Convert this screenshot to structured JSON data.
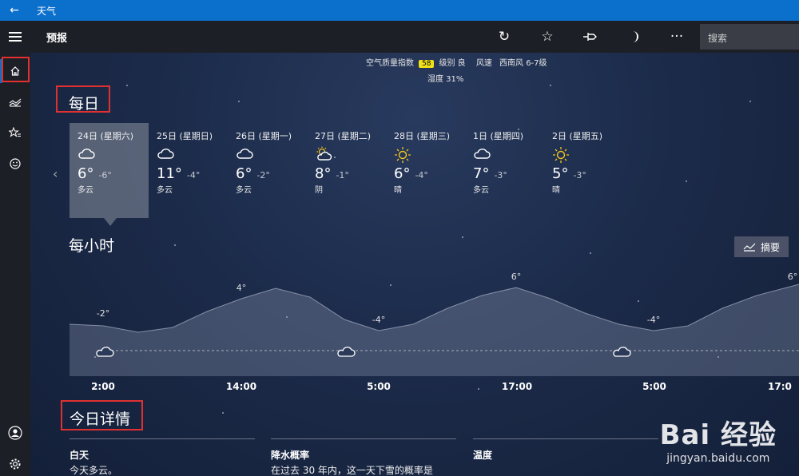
{
  "titlebar": {
    "back_icon": "back-arrow-icon",
    "title": "天气"
  },
  "commandbar": {
    "title": "预报",
    "actions": [
      {
        "name": "refresh-icon",
        "glyph": "↻"
      },
      {
        "name": "favorite-star-icon",
        "glyph": "☆"
      },
      {
        "name": "pin-icon",
        "glyph": "⊣"
      },
      {
        "name": "dark-mode-moon-icon",
        "glyph": "☽"
      },
      {
        "name": "more-icon",
        "glyph": "···"
      }
    ],
    "search_placeholder": "搜索"
  },
  "nav": [
    {
      "name": "home-icon",
      "active": true
    },
    {
      "name": "historical-chart-icon",
      "active": false
    },
    {
      "name": "favorites-icon",
      "active": false
    },
    {
      "name": "smiley-icon",
      "active": false
    },
    {
      "name": "account-icon",
      "active": false
    },
    {
      "name": "settings-gear-icon",
      "active": false
    }
  ],
  "conditions": {
    "aqi_label": "空气质量指数",
    "aqi_value": "58",
    "level_label": "级别",
    "level_value": "良",
    "wind_label": "风速",
    "wind_value": "西南风 6-7级",
    "humidity": "湿度  31%"
  },
  "daily": {
    "title": "每日",
    "days": [
      {
        "name": "24日 (星期六)",
        "icon": "cloud",
        "high": "6°",
        "low": "-6°",
        "cond": "多云",
        "selected": true
      },
      {
        "name": "25日 (星期日)",
        "icon": "cloud",
        "high": "11°",
        "low": "-4°",
        "cond": "多云",
        "selected": false
      },
      {
        "name": "26日 (星期一)",
        "icon": "cloud",
        "high": "6°",
        "low": "-2°",
        "cond": "多云",
        "selected": false
      },
      {
        "name": "27日 (星期二)",
        "icon": "partly-sunny",
        "high": "8°",
        "low": "-1°",
        "cond": "阴",
        "selected": false
      },
      {
        "name": "28日 (星期三)",
        "icon": "sun",
        "high": "6°",
        "low": "-4°",
        "cond": "晴",
        "selected": false
      },
      {
        "name": "1日 (星期四)",
        "icon": "cloud",
        "high": "7°",
        "low": "-3°",
        "cond": "多云",
        "selected": false
      },
      {
        "name": "2日 (星期五)",
        "icon": "sun",
        "high": "5°",
        "low": "-3°",
        "cond": "晴",
        "selected": false
      }
    ]
  },
  "hourly": {
    "title": "每小时",
    "summary_label": "摘要",
    "time_labels": [
      "2:00",
      "14:00",
      "5:00",
      "17:00",
      "5:00",
      "17:0"
    ],
    "temp_labels": [
      "-2°",
      "4°",
      "-4°",
      "6°",
      "-4°",
      "6°"
    ]
  },
  "today": {
    "title": "今日详情",
    "columns": [
      {
        "title": "白天",
        "text": "今天多云。"
      },
      {
        "title": "降水概率",
        "text": "在过去 30 年内，这一天下雪的概率是"
      },
      {
        "title": "温度",
        "text": ""
      }
    ]
  },
  "watermark": {
    "logo": "Bai 经验",
    "url": "jingyan.baidu.com"
  },
  "colors": {
    "accent": "#0b6fcc",
    "highlight": "#e03030",
    "aqi_badge": "#f2e017"
  }
}
